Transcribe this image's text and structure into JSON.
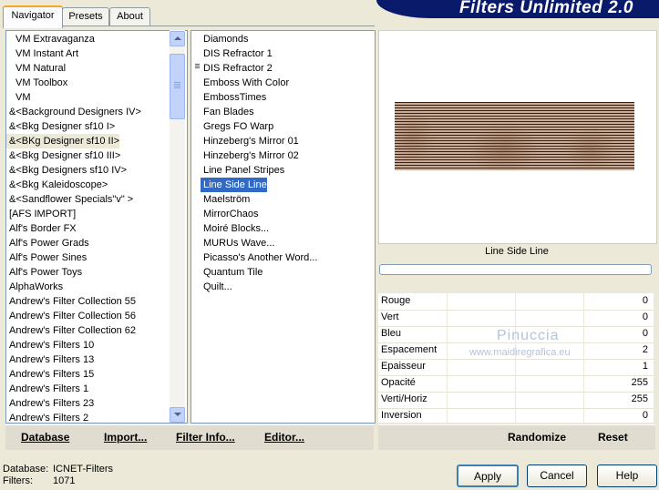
{
  "tabs": [
    {
      "label": "Navigator",
      "active": true
    },
    {
      "label": "Presets",
      "active": false
    },
    {
      "label": "About",
      "active": false
    }
  ],
  "banner": {
    "title": "Filters Unlimited 2.0"
  },
  "categories": {
    "items": [
      "VM Extravaganza",
      "VM Instant Art",
      "VM Natural",
      "VM Toolbox",
      "VM",
      "&<Background Designers IV>",
      "&<Bkg Designer sf10 I>",
      "&<BKg Designer sf10 II>",
      "&<Bkg Designer sf10 III>",
      "&<Bkg Designers sf10 IV>",
      "&<Bkg Kaleidoscope>",
      "&<Sandflower Specials\"v\" >",
      "[AFS IMPORT]",
      "Alf's Border FX",
      "Alf's Power Grads",
      "Alf's Power Sines",
      "Alf's Power Toys",
      "AlphaWorks",
      "Andrew's Filter Collection 55",
      "Andrew's Filter Collection 56",
      "Andrew's Filter Collection 62",
      "Andrew's Filters 10",
      "Andrew's Filters 13",
      "Andrew's Filters 15",
      "Andrew's Filters 1",
      "Andrew's Filters 23",
      "Andrew's Filters 2"
    ],
    "selected": "&<BKg Designer sf10 II>"
  },
  "filters": {
    "items": [
      "Diamonds",
      "DIS Refractor 1",
      "DIS Refractor 2",
      "Emboss With Color",
      "EmbossTimes",
      "Fan Blades",
      "Gregs FO Warp",
      "Hinzeberg's Mirror 01",
      "Hinzeberg's Mirror 02",
      "Line Panel Stripes",
      "Line Side Line",
      "Maelström",
      "MirrorChaos",
      "Moiré Blocks...",
      "MURUs Wave...",
      "Picasso's Another Word...",
      "Quantum Tile",
      "Quilt..."
    ],
    "selected": "Line Side Line"
  },
  "left_bar": {
    "database": "Database",
    "import": "Import...",
    "filter_info": "Filter Info...",
    "editor": "Editor..."
  },
  "preview": {
    "filter_name": "Line Side Line"
  },
  "params": [
    {
      "name": "Rouge",
      "value": "0"
    },
    {
      "name": "Vert",
      "value": "0"
    },
    {
      "name": "Bleu",
      "value": "0"
    },
    {
      "name": "Espacement",
      "value": "2"
    },
    {
      "name": "Epaisseur",
      "value": "1"
    },
    {
      "name": "Opacité",
      "value": "255"
    },
    {
      "name": "Verti/Horiz",
      "value": "255"
    },
    {
      "name": "Inversion",
      "value": "0"
    }
  ],
  "watermark": {
    "line1": "Pinuccia",
    "line2": "www.maidiregrafica.eu"
  },
  "right_bar": {
    "randomize": "Randomize",
    "reset": "Reset"
  },
  "status": {
    "database_label": "Database:",
    "database_value": "ICNET-Filters",
    "filters_label": "Filters:",
    "filters_value": "1071"
  },
  "buttons": {
    "apply": "Apply",
    "cancel": "Cancel",
    "help": "Help"
  }
}
